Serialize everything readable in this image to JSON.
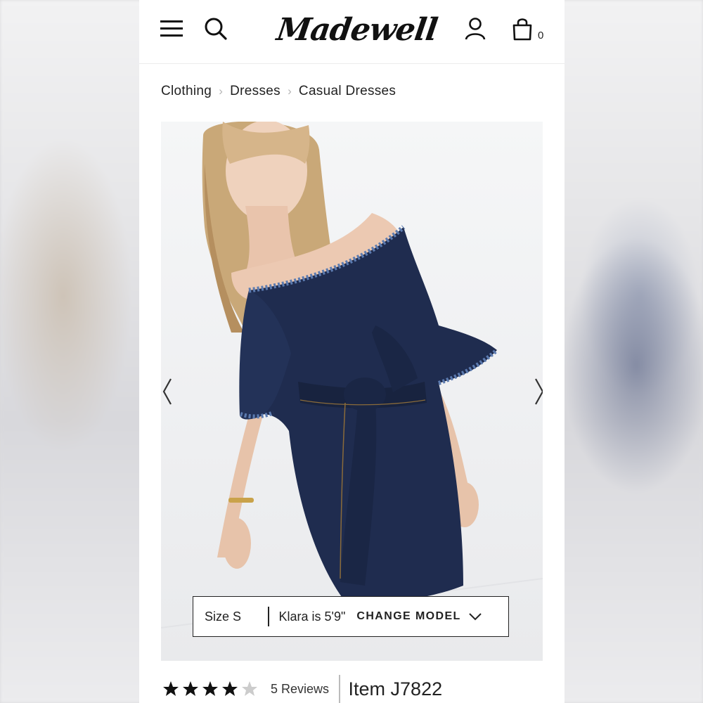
{
  "header": {
    "brand": "Madewell",
    "cart_count": "0",
    "icons": [
      "menu-icon",
      "search-icon",
      "account-icon",
      "shopping-bag-icon"
    ]
  },
  "breadcrumb": {
    "items": [
      "Clothing",
      "Dresses",
      "Casual Dresses"
    ],
    "separator": ">"
  },
  "gallery": {
    "image_subject": "model wearing off-the-shoulder dark denim tie-waist dress",
    "prev_icon": "chevron-left-icon",
    "next_icon": "chevron-right-icon"
  },
  "model_info": {
    "size": "Size S",
    "model": "Klara is 5'9\"",
    "change_label": "CHANGE MODEL",
    "toggle_icon": "chevron-down-icon"
  },
  "product": {
    "rating": 4,
    "rating_max": 5,
    "reviews": "5 Reviews",
    "item_number": "Item J7822"
  },
  "colors": {
    "denim": "#1f2c4f",
    "text": "#222222",
    "star_filled": "#111111",
    "star_empty": "#cccccc"
  }
}
